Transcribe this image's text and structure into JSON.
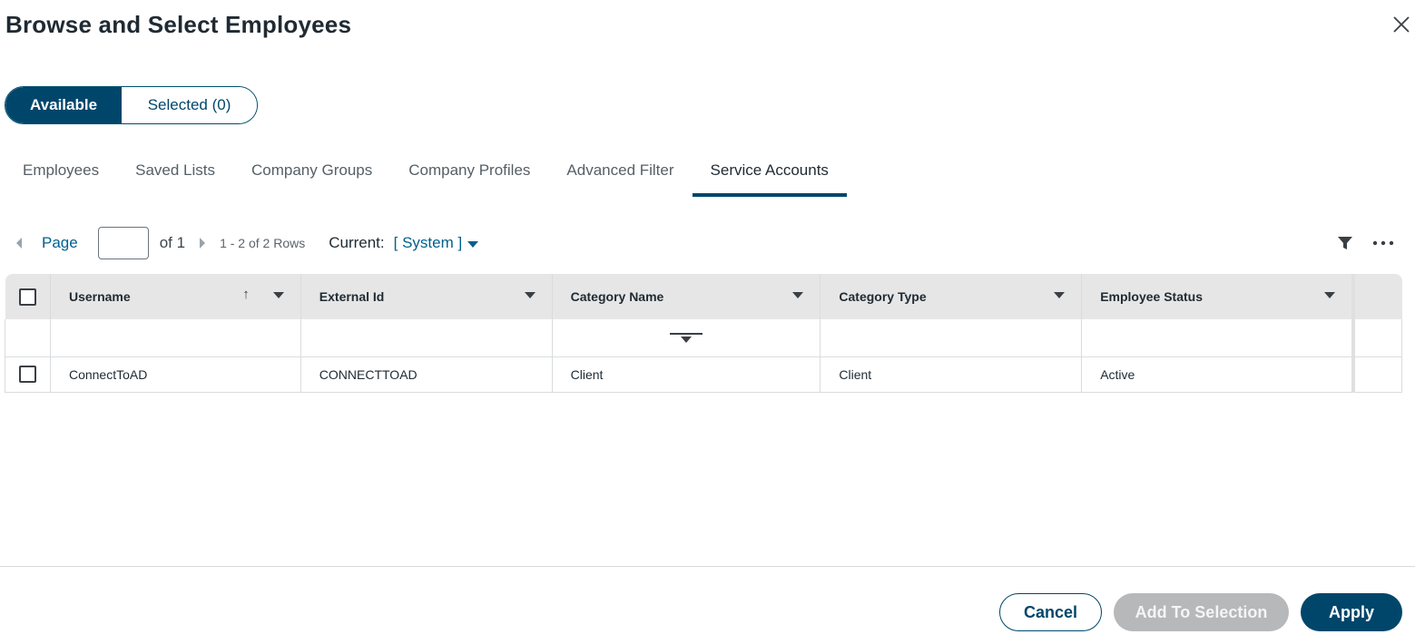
{
  "dialog": {
    "title": "Browse and Select Employees",
    "close_icon": "close-icon"
  },
  "toggle": {
    "available": "Available",
    "selected": "Selected (0)",
    "active": "available"
  },
  "tabs": [
    {
      "label": "Employees",
      "active": false
    },
    {
      "label": "Saved Lists",
      "active": false
    },
    {
      "label": "Company Groups",
      "active": false
    },
    {
      "label": "Company Profiles",
      "active": false
    },
    {
      "label": "Advanced Filter",
      "active": false
    },
    {
      "label": "Service Accounts",
      "active": true
    }
  ],
  "pager": {
    "page_label": "Page",
    "page_value": "",
    "of_label": "of 1",
    "rows_label": "1 - 2 of 2 Rows",
    "current_label": "Current:",
    "current_value": "[ System ]"
  },
  "table": {
    "columns": [
      "Username",
      "External Id",
      "Category Name",
      "Category Type",
      "Employee Status"
    ],
    "sort": {
      "column": "Username",
      "direction": "ascending"
    },
    "rows": [
      {
        "username": "ConnectToAD",
        "external_id": "CONNECTTOAD",
        "category_name": "Client",
        "category_type": "Client",
        "employee_status": "Active"
      }
    ]
  },
  "footer": {
    "cancel": "Cancel",
    "add_to_selection": "Add To Selection",
    "apply": "Apply"
  },
  "colors": {
    "primary": "#00466b",
    "link": "#00608f",
    "disabled_button": "#b7b8b9",
    "header_bg": "#e6e6e6"
  }
}
